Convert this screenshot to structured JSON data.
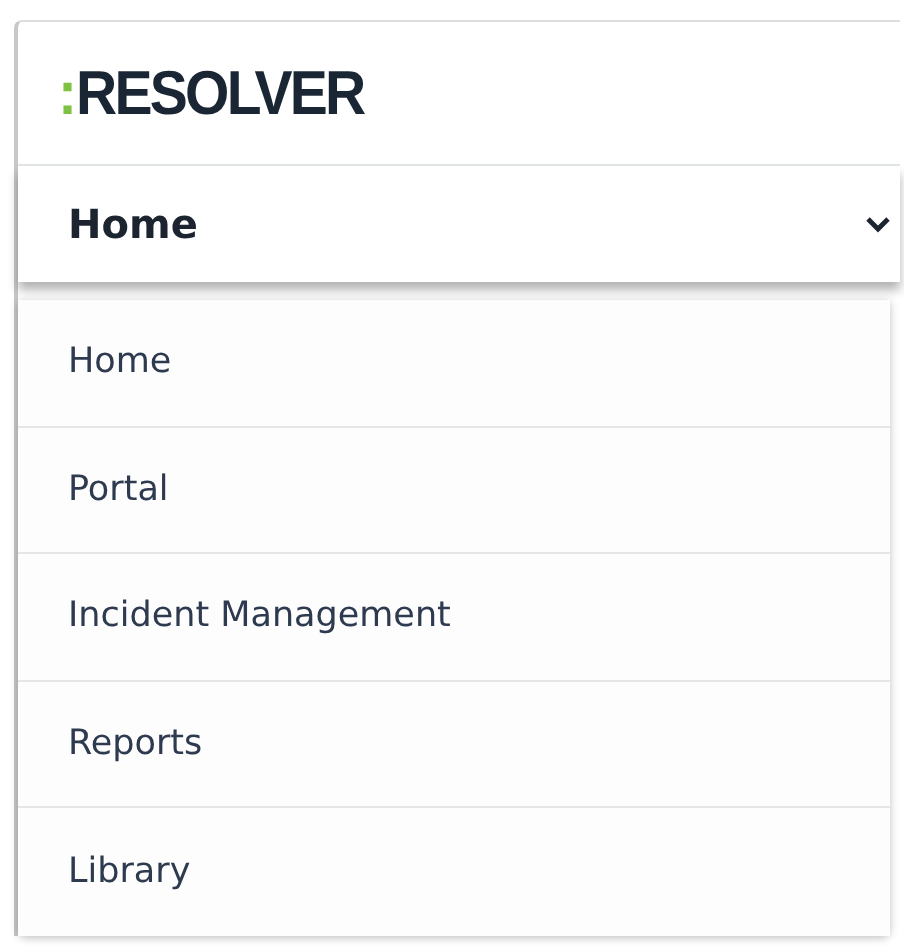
{
  "logo": {
    "mark": ":",
    "text": "RESOLVER"
  },
  "dropdown": {
    "label": "Home",
    "expanded": true
  },
  "menu": [
    {
      "label": "Home"
    },
    {
      "label": "Portal"
    },
    {
      "label": "Incident Management"
    },
    {
      "label": "Reports"
    },
    {
      "label": "Library"
    }
  ]
}
